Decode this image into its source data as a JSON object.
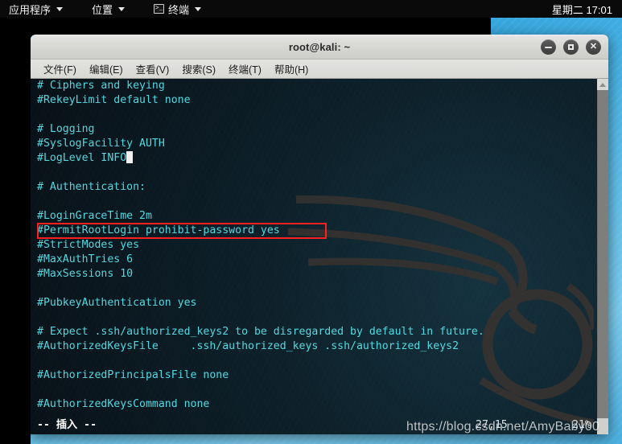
{
  "panel": {
    "applications_label": "应用程序",
    "places_label": "位置",
    "terminal_label": "终端",
    "terminal_icon_glyph": ">_",
    "clock": "星期二 17:01"
  },
  "window": {
    "title": "root@kali: ~",
    "minimize_glyph": "",
    "maximize_glyph": "",
    "close_glyph": "✕",
    "menu": [
      {
        "label": "文件(F)"
      },
      {
        "label": "编辑(E)"
      },
      {
        "label": "查看(V)"
      },
      {
        "label": "搜索(S)"
      },
      {
        "label": "终端(T)"
      },
      {
        "label": "帮助(H)"
      }
    ]
  },
  "terminal": {
    "lines": [
      "# Ciphers and keying",
      "#RekeyLimit default none",
      "",
      "# Logging",
      "#SyslogFacility AUTH",
      "#LogLevel INFO",
      "",
      "# Authentication:",
      "",
      "#LoginGraceTime 2m",
      "#PermitRootLogin prohibit-password yes",
      "#StrictModes yes",
      "#MaxAuthTries 6",
      "#MaxSessions 10",
      "",
      "#PubkeyAuthentication yes",
      "",
      "# Expect .ssh/authorized_keys2 to be disregarded by default in future.",
      "#AuthorizedKeysFile     .ssh/authorized_keys .ssh/authorized_keys2",
      "",
      "#AuthorizedPrincipalsFile none",
      "",
      "#AuthorizedKeysCommand none"
    ],
    "cursor_line_index": 5,
    "highlight_line_index": 10,
    "status_mode": "-- 插入 --",
    "cursor_position": "27,15",
    "scroll_percent": "21%",
    "text_color": "#54d8e0",
    "highlight_color": "#ff2020",
    "background_color": "#0c1c24"
  },
  "watermark": {
    "text": "https://blog.csdn.net/AmyBaby00"
  }
}
